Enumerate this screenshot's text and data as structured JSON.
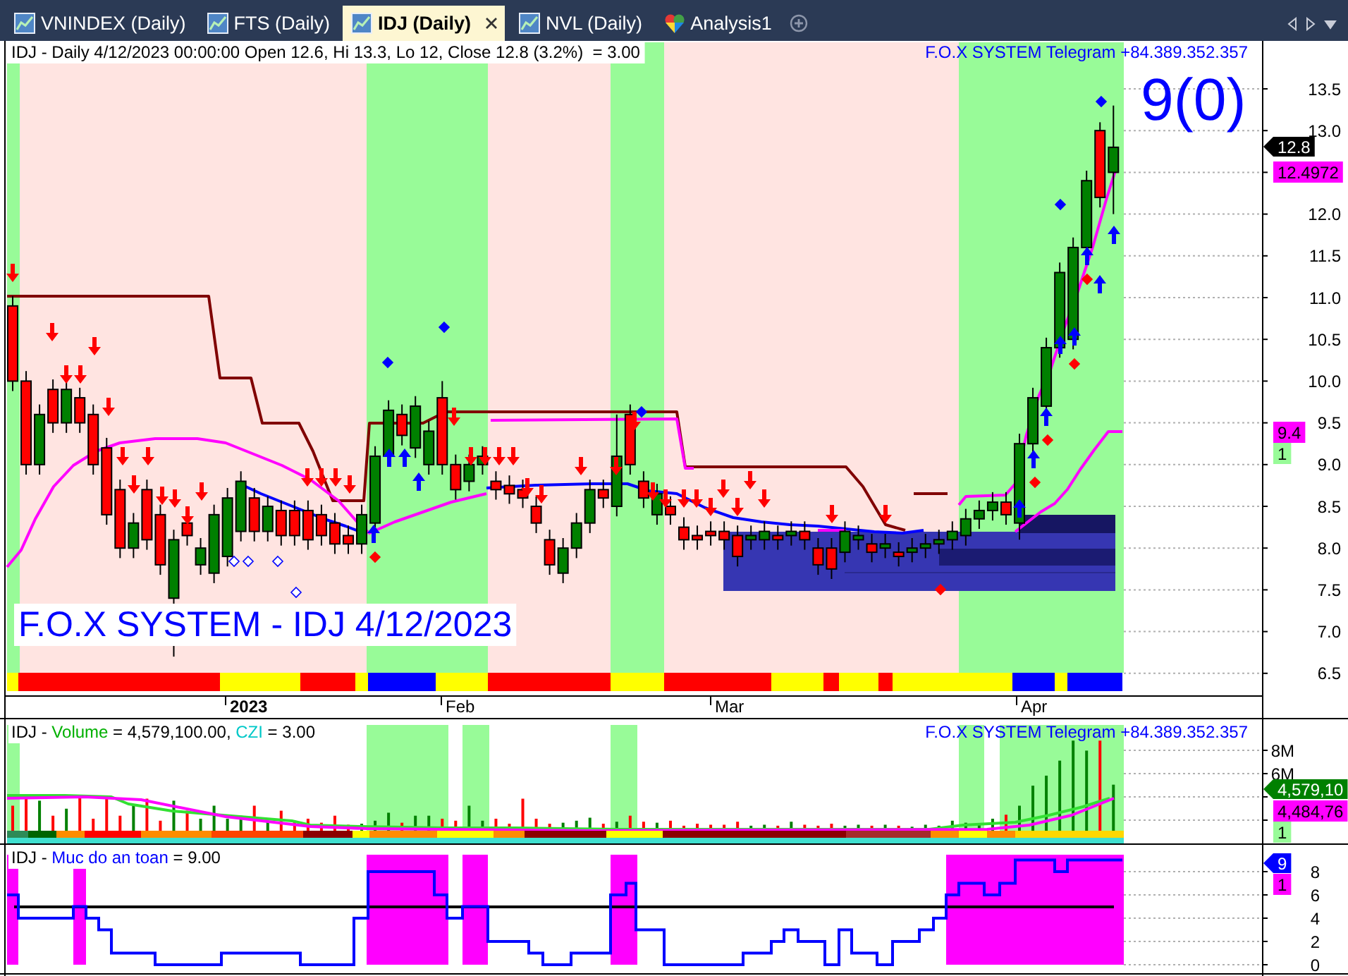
{
  "tabs": [
    {
      "label": "VNINDEX (Daily)",
      "kind": "chart",
      "selected": false
    },
    {
      "label": "FTS (Daily)",
      "kind": "chart",
      "selected": false
    },
    {
      "label": "IDJ (Daily)",
      "kind": "chart",
      "selected": true
    },
    {
      "label": "NVL (Daily)",
      "kind": "chart",
      "selected": false
    },
    {
      "label": "Analysis1",
      "kind": "analysis",
      "selected": false
    }
  ],
  "price_panel": {
    "title": "IDJ - Daily 4/12/2023 00:00:00 Open 12.6, Hi 13.3, Lo 12, Close 12.8 (3.2%)  = 3.00",
    "contact": "F.O.X SYSTEM Telegram +84.389.352.357",
    "signal_count": "9(0)",
    "caption": "F.O.X SYSTEM - IDJ 4/12/2023",
    "y_ticks": [
      "13.5",
      "13.0",
      "12.0",
      "11.5",
      "11.0",
      "10.5",
      "10.0",
      "9.5",
      "9.0",
      "8.5",
      "8.0",
      "7.5",
      "7.0",
      "6.5"
    ],
    "value_labels": [
      {
        "text": "12.8",
        "kind": "pointer",
        "color": "#000000"
      },
      {
        "text": "12.4972",
        "kind": "box",
        "color": "#ff00ff"
      },
      {
        "text": "9.4",
        "kind": "box",
        "color": "#ff00ff"
      },
      {
        "text": "1",
        "kind": "box",
        "color": "#98fb98"
      }
    ],
    "x_labels": [
      {
        "text": "2023",
        "bold": true
      },
      {
        "text": "Feb",
        "bold": false
      },
      {
        "text": "Mar",
        "bold": false
      },
      {
        "text": "Apr",
        "bold": false
      }
    ]
  },
  "volume_panel": {
    "title": [
      {
        "text": "IDJ - ",
        "color": "#000000"
      },
      {
        "text": "Volume",
        "color": "#00b000"
      },
      {
        "text": " = 4,579,100.00, ",
        "color": "#000000"
      },
      {
        "text": "CZI",
        "color": "#00c8c8"
      },
      {
        "text": " = 3.00",
        "color": "#000000"
      }
    ],
    "contact": "F.O.X SYSTEM Telegram +84.389.352.357",
    "y_ticks": [
      "8M",
      "6M"
    ],
    "value_labels": [
      {
        "text": "4,579,10",
        "kind": "pointer",
        "color": "#008000"
      },
      {
        "text": "4,484,76",
        "kind": "box",
        "color": "#ff00ff"
      },
      {
        "text": "1",
        "kind": "box",
        "color": "#98fb98"
      }
    ]
  },
  "safety_panel": {
    "title": [
      {
        "text": "IDJ - ",
        "color": "#000000"
      },
      {
        "text": "Muc do an toan",
        "color": "#0000ff"
      },
      {
        "text": " = 9.00",
        "color": "#000000"
      }
    ],
    "y_ticks": [
      "8",
      "6",
      "4",
      "2",
      "0"
    ],
    "value_labels": [
      {
        "text": "9",
        "kind": "pointer",
        "color": "#0000ff"
      },
      {
        "text": "1",
        "kind": "box",
        "color": "#ff00ff"
      }
    ]
  }
}
